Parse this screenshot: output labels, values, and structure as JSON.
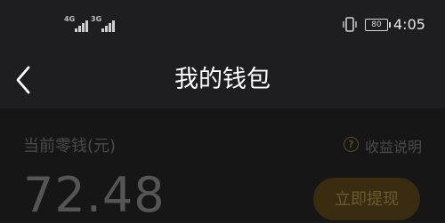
{
  "status_bar": {
    "network_1": "4G",
    "network_2": "3G",
    "battery": "80",
    "time": "4:05",
    "icons": [
      "signal-icon",
      "signal-icon",
      "vibrate-icon",
      "battery-icon"
    ]
  },
  "nav": {
    "back_icon": "chevron-left-icon",
    "title": "我的钱包"
  },
  "wallet": {
    "balance_label": "当前零钱(元)",
    "help_icon": "question-circle-icon",
    "help_label": "收益说明",
    "balance": "72.48",
    "withdraw_label": "立即提现"
  },
  "colors": {
    "background": "#1c1c1e",
    "accent": "#3a2c10"
  }
}
